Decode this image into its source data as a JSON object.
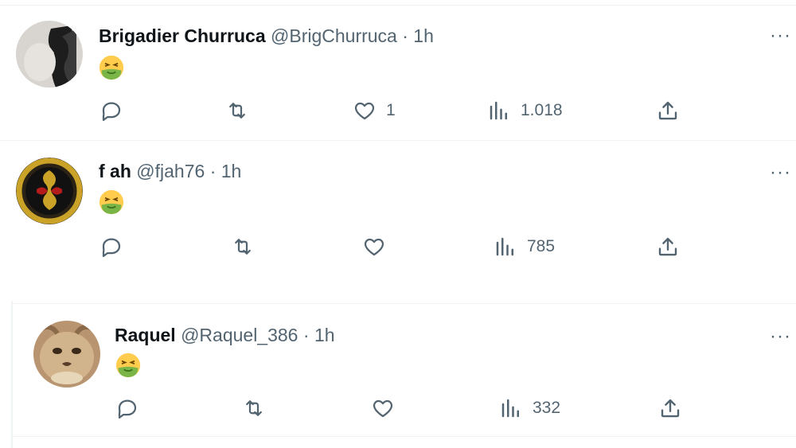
{
  "tweets": [
    {
      "name": "Brigadier Churruca",
      "handle": "@BrigChurruca",
      "time": "1h",
      "separator": "·",
      "emoji": "nauseated-face",
      "replies": "",
      "retweets": "",
      "likes": "1",
      "views": "1.018"
    },
    {
      "name": "f ah",
      "handle": "@fjah76",
      "time": "1h",
      "separator": "·",
      "emoji": "nauseated-face",
      "replies": "",
      "retweets": "",
      "likes": "",
      "views": "785"
    },
    {
      "name": "Raquel",
      "handle": "@Raquel_386",
      "time": "1h",
      "separator": "·",
      "emoji": "nauseated-face",
      "replies": "",
      "retweets": "",
      "likes": "",
      "views": "332"
    }
  ],
  "more_label": "···",
  "colors": {
    "text": "#0f1419",
    "secondary": "#536471",
    "divider": "#eff3f4",
    "nausea_green": "#7ab547",
    "face_yellow": "#ffcc4d"
  }
}
